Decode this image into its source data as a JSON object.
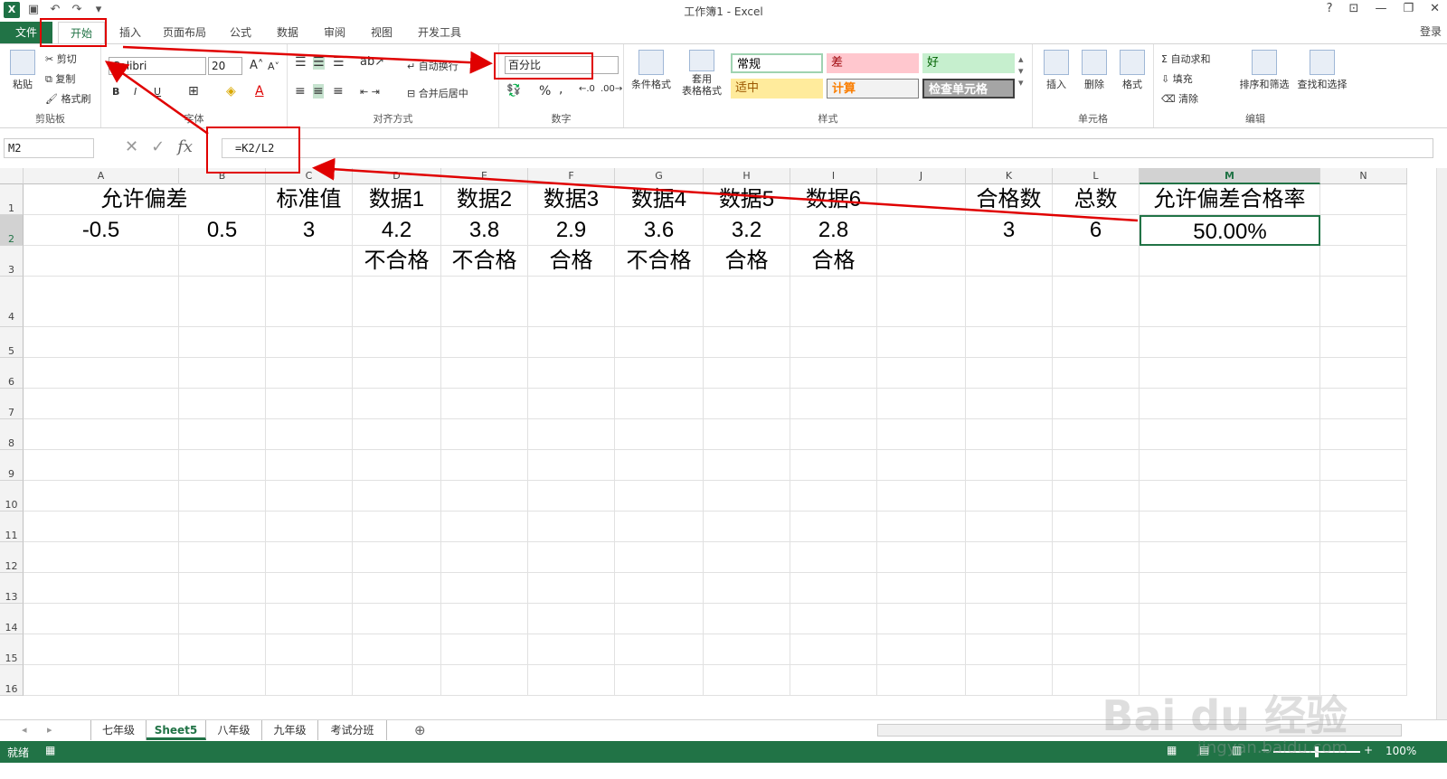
{
  "window": {
    "title": "工作簿1 - Excel",
    "login": "登录"
  },
  "tabs": [
    "文件",
    "开始",
    "插入",
    "页面布局",
    "公式",
    "数据",
    "审阅",
    "视图",
    "开发工具"
  ],
  "ribbon": {
    "clipboard": {
      "label": "剪贴板",
      "paste": "粘贴",
      "cut": "剪切",
      "copy": "复制",
      "painter": "格式刷"
    },
    "font": {
      "label": "字体",
      "name": "Calibri",
      "size": "20",
      "bold": "B",
      "italic": "I",
      "underline": "U"
    },
    "align": {
      "label": "对齐方式",
      "wrap": "自动换行",
      "merge": "合并后居中"
    },
    "number": {
      "label": "数字",
      "format": "百分比",
      "percent": "%",
      "comma": ","
    },
    "styles": {
      "label": "样式",
      "cond": "条件格式",
      "table1": "套用",
      "table2": "表格格式",
      "normal": "常规",
      "bad": "差",
      "good": "好",
      "neutral": "适中",
      "calc": "计算",
      "check": "检查单元格"
    },
    "cells": {
      "label": "单元格",
      "insert": "插入",
      "delete": "删除",
      "format": "格式"
    },
    "edit": {
      "label": "编辑",
      "autosum": "自动求和",
      "fill": "填充",
      "clear": "清除",
      "sort": "排序和筛选",
      "find": "查找和选择"
    }
  },
  "formula_bar": {
    "name_box": "M2",
    "formula": "=K2/L2",
    "fx": "fx"
  },
  "columns": [
    "A",
    "B",
    "C",
    "D",
    "E",
    "F",
    "G",
    "H",
    "I",
    "J",
    "K",
    "L",
    "M",
    "N"
  ],
  "rows": [
    "1",
    "2",
    "3",
    "4",
    "5",
    "6",
    "7",
    "8",
    "9",
    "10",
    "11",
    "12",
    "13",
    "14",
    "15",
    "16"
  ],
  "cells": {
    "A1": "允许偏差",
    "C1": "标准值",
    "D1": "数据1",
    "E1": "数据2",
    "F1": "数据3",
    "G1": "数据4",
    "H1": "数据5",
    "I1": "数据6",
    "K1": "合格数",
    "L1": "总数",
    "M1": "允许偏差合格率",
    "A2": "-0.5",
    "B2": "0.5",
    "C2": "3",
    "D2": "4.2",
    "E2": "3.8",
    "F2": "2.9",
    "G2": "3.6",
    "H2": "3.2",
    "I2": "2.8",
    "K2": "3",
    "L2": "6",
    "M2": "50.00%",
    "D3": "不合格",
    "E3": "不合格",
    "F3": "合格",
    "G3": "不合格",
    "H3": "合格",
    "I3": "合格"
  },
  "sheets": [
    "七年级",
    "Sheet5",
    "八年级",
    "九年级",
    "考试分班"
  ],
  "active_sheet": "Sheet5",
  "status": {
    "ready": "就绪",
    "zoom": "100%"
  },
  "watermark": {
    "main": "Bai du 经验",
    "sub": "jingyan.baidu.com"
  },
  "colors": {
    "excel_green": "#217346",
    "annotation_red": "#e00000"
  }
}
